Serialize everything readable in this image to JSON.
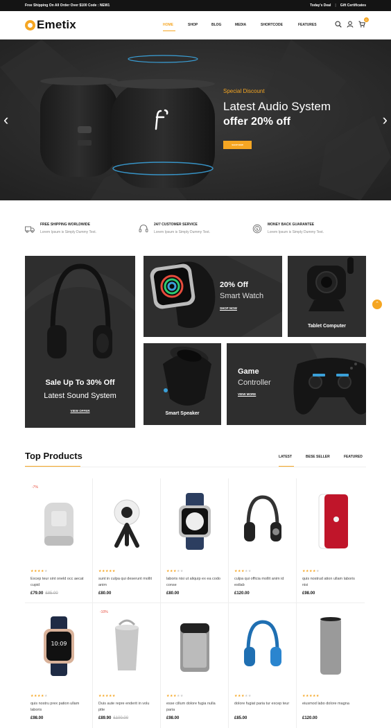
{
  "topbar": {
    "promo": "Free Shipping On All Order Over $100 Code : NEW1",
    "todays_deal": "Today's Deal",
    "separator": "|",
    "gift": "Gift Certificates"
  },
  "header": {
    "logo": "Emetix",
    "nav": [
      "HOME",
      "SHOP",
      "BLOG",
      "MEDIA",
      "SHORTCODE",
      "FEATURES"
    ],
    "cart_count": "0",
    "accent_color": "#f5a623"
  },
  "hero": {
    "subtitle": "Special Discount",
    "title": "Latest Audio System",
    "offer": "offer 20% off",
    "button": "SHOP NOW",
    "prev": "‹",
    "next": "›"
  },
  "features": [
    {
      "icon": "truck-icon",
      "title": "FREE SHIPPING WORLDWIDE",
      "desc": "Lorem Ipsum is Simply Dummy Text."
    },
    {
      "icon": "headset-icon",
      "title": "24/7 CUSTOMER SERVICE",
      "desc": "Lorem Ipsum is Simply Dummy Text."
    },
    {
      "icon": "money-back-icon",
      "title": "MONEY BACK GUARANTEE",
      "desc": "Lorem Ipsum is Simply Dummy Text."
    }
  ],
  "banners": {
    "headphones": {
      "title": "Sale Up To 30% Off",
      "subtitle": "Latest Sound System",
      "link": "VIEW OFFER"
    },
    "watch": {
      "title": "20% Off",
      "subtitle": "Smart Watch",
      "link": "SHOP NOW"
    },
    "camera": {
      "title": "Tablet Computer"
    },
    "speaker": {
      "title": "Smart Speaker"
    },
    "controller": {
      "title": "Game",
      "subtitle": "Controller",
      "link": "VIEW MORE"
    }
  },
  "scroll_top": "⌃",
  "top_products": {
    "title": "Top Products",
    "tabs": [
      "LATEST",
      "BESE SELLER",
      "FEATURED"
    ],
    "products": [
      {
        "name": "Excep teur sint oneld occ aecat cupid",
        "price": "£79.00",
        "old_price": "£85.00",
        "rating": 4,
        "sale": "-7%",
        "icon": "smart-speaker-icon"
      },
      {
        "name": "sunt in culpa qui deserunt mollit anim",
        "price": "£80.00",
        "old_price": "",
        "rating": 5,
        "sale": "",
        "icon": "360-camera-icon"
      },
      {
        "name": "laboris nisi ut aliquip ex ea codo conse",
        "price": "£80.00",
        "old_price": "",
        "rating": 3,
        "sale": "",
        "icon": "smartwatch-icon"
      },
      {
        "name": "culpa qui officia mollit anim id estlab",
        "price": "£120.00",
        "old_price": "",
        "rating": 3,
        "sale": "",
        "icon": "headphones-icon"
      },
      {
        "name": "quis nostrud ation ullam laboris nisi",
        "price": "£98.00",
        "old_price": "",
        "rating": 4,
        "sale": "",
        "icon": "phone-icon"
      },
      {
        "name": "quis nostru prex pation ullam laboris",
        "price": "£98.00",
        "old_price": "",
        "rating": 4,
        "sale": "",
        "icon": "watch-icon"
      },
      {
        "name": "Duis aute repre enderit in volu ptte",
        "price": "£89.90",
        "old_price": "£100.00",
        "rating": 5,
        "sale": "-10%",
        "icon": "bluetooth-speaker-icon"
      },
      {
        "name": "esse cillum dolore fugia nulla paria",
        "price": "£98.00",
        "old_price": "",
        "rating": 3,
        "sale": "",
        "icon": "bread-maker-icon"
      },
      {
        "name": "dolore fugiat paria tur excep teur",
        "price": "£85.00",
        "old_price": "",
        "rating": 3,
        "sale": "",
        "icon": "blue-headphones-icon"
      },
      {
        "name": "eiusmod labo dolore magna",
        "price": "£120.00",
        "old_price": "",
        "rating": 5,
        "sale": "",
        "icon": "echo-speaker-icon"
      }
    ]
  }
}
